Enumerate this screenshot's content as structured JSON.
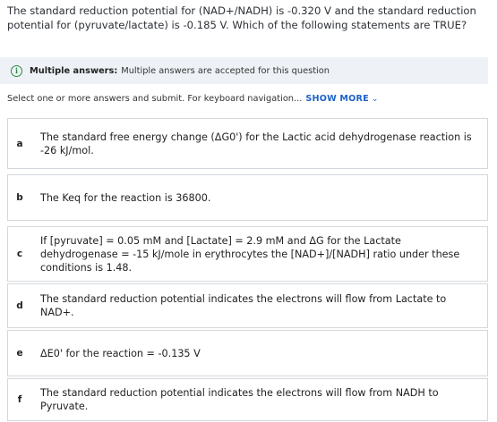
{
  "question": {
    "text": "The standard reduction potential for (NAD+/NADH) is -0.320 V and the standard reduction potential for (pyruvate/lactate) is -0.185 V. Which of the following statements are TRUE?"
  },
  "notice": {
    "icon": "info-icon",
    "title": "Multiple answers:",
    "text": "Multiple answers are accepted for this question"
  },
  "instruction": {
    "text": "Select one or more answers and submit. For keyboard navigation...",
    "show_more": "SHOW MORE",
    "chevron": "⌄"
  },
  "options": [
    {
      "letter": "a",
      "text": "The standard free energy change (ΔG0') for the Lactic acid dehydrogenase reaction is -26 kJ/mol."
    },
    {
      "letter": "b",
      "text": "The Keq for the reaction is 36800."
    },
    {
      "letter": "c",
      "text": "If [pyruvate] = 0.05 mM and [Lactate] = 2.9 mM and ΔG for the Lactate dehydrogenase = -15 kJ/mole in erythrocytes the [NAD+]/[NADH] ratio under these conditions is 1.48."
    },
    {
      "letter": "d",
      "text": "The standard reduction potential indicates the electrons will flow from Lactate to NAD+."
    },
    {
      "letter": "e",
      "text": "ΔE0' for the reaction = -0.135 V"
    },
    {
      "letter": "f",
      "text": "The standard reduction potential indicates the electrons will flow from NADH to Pyruvate."
    }
  ]
}
